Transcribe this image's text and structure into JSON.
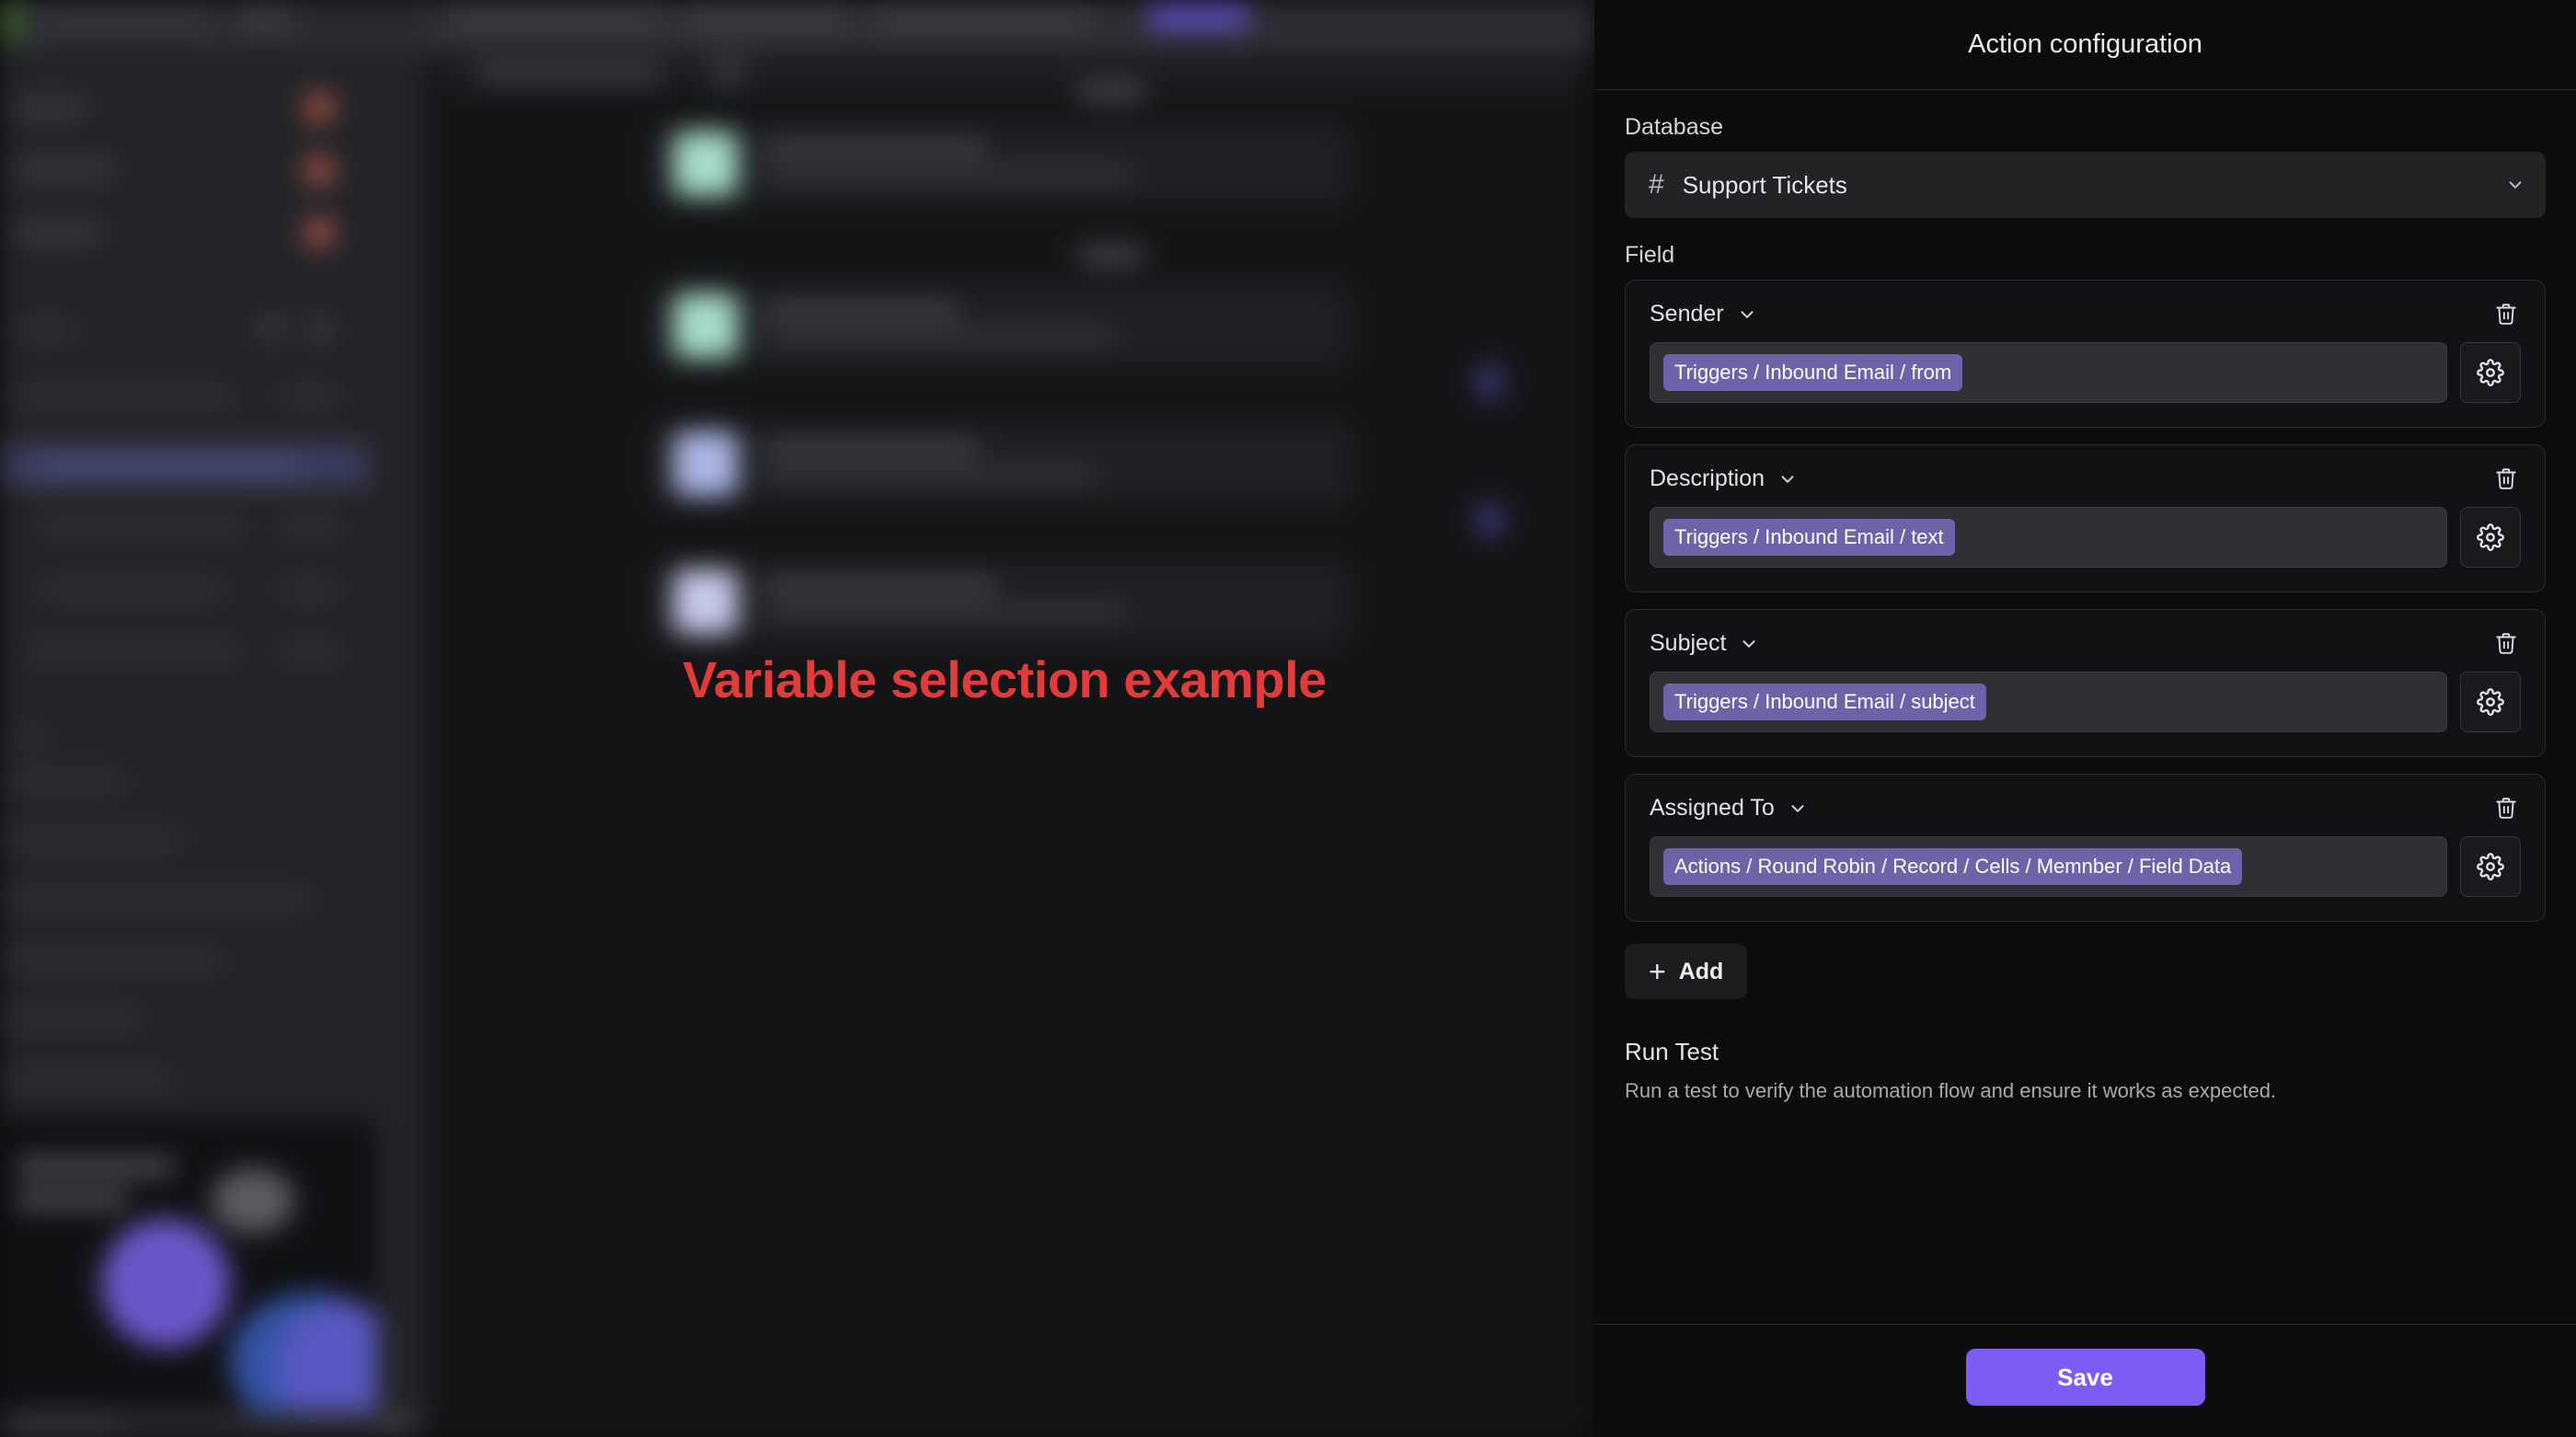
{
  "annotation": {
    "text": "Variable selection example",
    "color": "#e03c3c"
  },
  "panel": {
    "title": "Action configuration",
    "database": {
      "label": "Database",
      "icon": "hash-icon",
      "value": "Support Tickets",
      "chevron": "chevron-down-icon"
    },
    "fields_label": "Field",
    "fields": [
      {
        "name": "Sender",
        "chevron": "chevron-down-icon",
        "variable": "Triggers / Inbound Email / from",
        "delete_icon": "trash-icon",
        "settings_icon": "gear-icon"
      },
      {
        "name": "Description",
        "chevron": "chevron-down-icon",
        "variable": "Triggers / Inbound Email / text",
        "delete_icon": "trash-icon",
        "settings_icon": "gear-icon"
      },
      {
        "name": "Subject",
        "chevron": "chevron-down-icon",
        "variable": "Triggers / Inbound Email / subject",
        "delete_icon": "trash-icon",
        "settings_icon": "gear-icon"
      },
      {
        "name": "Assigned To",
        "chevron": "chevron-down-icon",
        "variable": "Actions / Round Robin / Record / Cells / Memnber / Field Data",
        "delete_icon": "trash-icon",
        "settings_icon": "gear-icon"
      }
    ],
    "add_button": {
      "label": "Add",
      "icon": "plus-icon"
    },
    "run_test": {
      "title": "Run Test",
      "description": "Run a test to verify the automation flow and ensure it works as expected."
    },
    "save_button": {
      "label": "Save",
      "color": "#7c5cf5"
    }
  },
  "colors": {
    "accent_purple": "#7c5cf5",
    "chip_purple": "#6d63a8",
    "panel_bg": "#0c0c0d",
    "card_bg": "#121214",
    "input_bg": "#303034",
    "annotation_red": "#e03c3c"
  }
}
